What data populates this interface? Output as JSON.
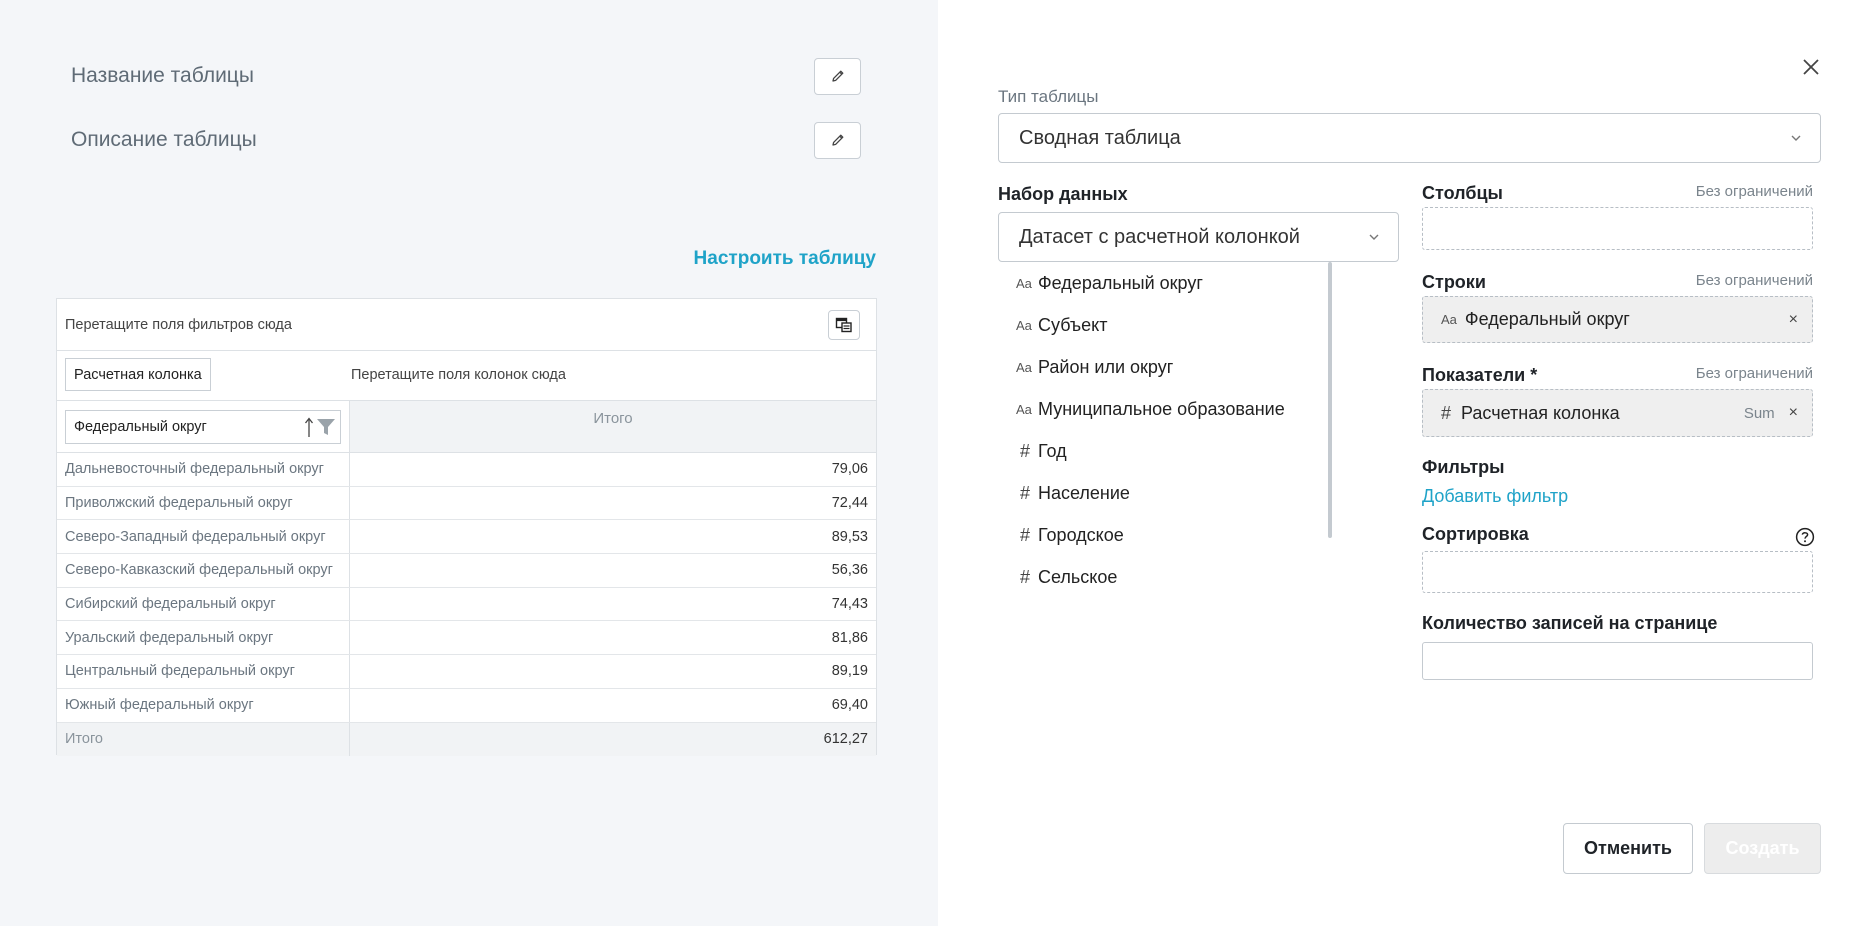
{
  "left": {
    "table_name_label": "Название таблицы",
    "table_description_label": "Описание таблицы",
    "configure_link": "Настроить таблицу",
    "pivot": {
      "filter_hint": "Перетащите поля фильтров сюда",
      "column_chip": "Расчетная колонка",
      "column_hint": "Перетащите поля колонок сюда",
      "row_chip": "Федеральный округ",
      "total_header": "Итого",
      "rows": [
        {
          "name": "Дальневосточный федеральный округ",
          "value": "79,06"
        },
        {
          "name": "Приволжский федеральный округ",
          "value": "72,44"
        },
        {
          "name": "Северо-Западный федеральный округ",
          "value": "89,53"
        },
        {
          "name": "Северо-Кавказский федеральный округ",
          "value": "56,36"
        },
        {
          "name": "Сибирский федеральный округ",
          "value": "74,43"
        },
        {
          "name": "Уральский федеральный округ",
          "value": "81,86"
        },
        {
          "name": "Центральный федеральный округ",
          "value": "89,19"
        },
        {
          "name": "Южный федеральный округ",
          "value": "69,40"
        }
      ],
      "total_row": {
        "name": "Итого",
        "value": "612,27"
      }
    }
  },
  "right": {
    "table_type_label": "Тип таблицы",
    "table_type_value": "Сводная таблица",
    "dataset_label": "Набор данных",
    "dataset_value": "Датасет с расчетной колонкой",
    "dataset_fields": [
      {
        "type": "Aa",
        "label": "Федеральный округ"
      },
      {
        "type": "Aa",
        "label": "Субъект"
      },
      {
        "type": "Aa",
        "label": "Район или округ"
      },
      {
        "type": "Aa",
        "label": "Муниципальное образование"
      },
      {
        "type": "#",
        "label": "Год"
      },
      {
        "type": "#",
        "label": "Население"
      },
      {
        "type": "#",
        "label": "Городское"
      },
      {
        "type": "#",
        "label": "Сельское"
      }
    ],
    "columns_label": "Столбцы",
    "columns_limit": "Без ограничений",
    "rows_label": "Строки",
    "rows_limit": "Без ограничений",
    "rows_item": {
      "type": "Aa",
      "label": "Федеральный округ"
    },
    "measures_label": "Показатели *",
    "measures_limit": "Без ограничений",
    "measures_item": {
      "type": "#",
      "label": "Расчетная колонка",
      "agg": "Sum"
    },
    "filters_label": "Фильтры",
    "add_filter": "Добавить фильтр",
    "sort_label": "Сортировка",
    "page_size_label": "Количество записей на странице",
    "page_size_value": "",
    "remove_symbol": "×",
    "cancel_button": "Отменить",
    "create_button": "Создать"
  },
  "icons": {
    "edit": "pencil-icon",
    "toggle": "table-settings-icon",
    "sort": "sort-arrow-icon",
    "filter": "filter-funnel-icon",
    "chevron": "chevron-down-icon",
    "close": "close-icon",
    "help": "help-circle-icon"
  },
  "colors": {
    "accent": "#1fa3c8",
    "left_background": "#f4f6f9",
    "filled_chip": "#efefef"
  }
}
